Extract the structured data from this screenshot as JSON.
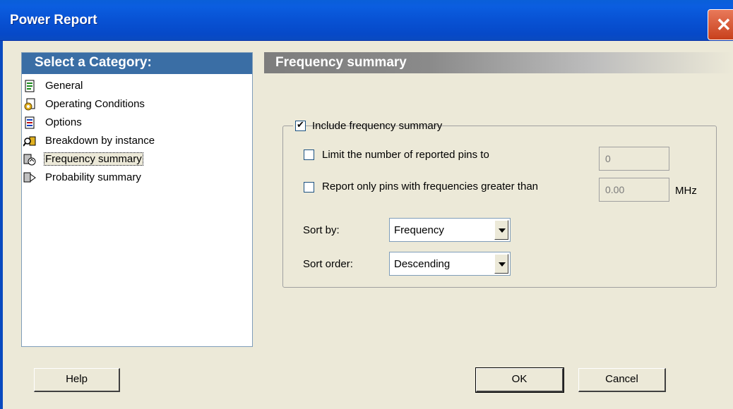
{
  "window": {
    "title": "Power Report",
    "close_symbol": "✕"
  },
  "category": {
    "header": "Select a Category:",
    "items": [
      {
        "label": "General",
        "icon": "document-icon"
      },
      {
        "label": "Operating Conditions",
        "icon": "settings-document-icon"
      },
      {
        "label": "Options",
        "icon": "document-list-icon"
      },
      {
        "label": "Breakdown by instance",
        "icon": "search-tree-icon"
      },
      {
        "label": "Frequency summary",
        "icon": "frequency-icon"
      },
      {
        "label": "Probability summary",
        "icon": "probability-icon"
      }
    ],
    "selected": "Frequency summary"
  },
  "section": {
    "title": "Frequency summary"
  },
  "frequency": {
    "include_label": "Include frequency summary",
    "include_checked": true,
    "limit_label": "Limit the number of reported pins to",
    "limit_checked": false,
    "limit_value": "0",
    "report_label": "Report only pins with frequencies greater than",
    "report_checked": false,
    "report_value": "0.00",
    "report_unit": "MHz",
    "sort_by_label": "Sort by:",
    "sort_by_value": "Frequency",
    "sort_order_label": "Sort order:",
    "sort_order_value": "Descending"
  },
  "buttons": {
    "help": "Help",
    "ok": "OK",
    "cancel": "Cancel"
  },
  "colors": {
    "titlebar": "#0852d4",
    "category_header": "#3a6ea5",
    "dialog_bg": "#ece9d8"
  }
}
